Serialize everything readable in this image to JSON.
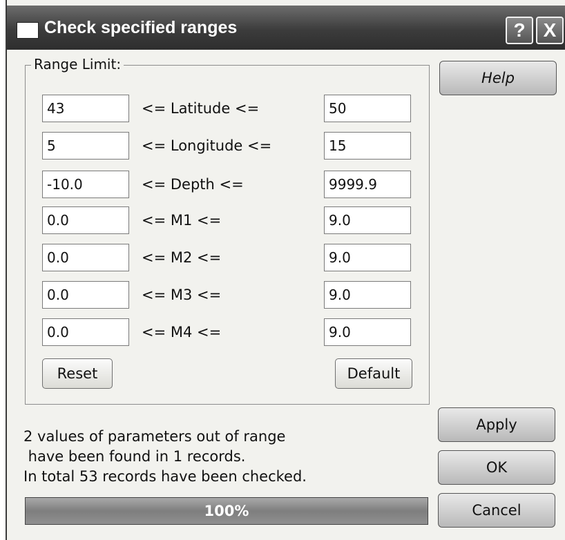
{
  "window": {
    "title": "Check specified ranges",
    "help_glyph": "?",
    "close_glyph": "X"
  },
  "range_group": {
    "label": "Range Limit:",
    "rows": [
      {
        "min": "43",
        "condition": "<= Latitude <=",
        "max": "50"
      },
      {
        "min": "5",
        "condition": "<= Longitude <=",
        "max": "15"
      },
      {
        "min": "-10.0",
        "condition": "<= Depth <=",
        "max": "9999.9"
      },
      {
        "min": "0.0",
        "condition": "<= M1 <=",
        "max": "9.0"
      },
      {
        "min": "0.0",
        "condition": "<= M2 <=",
        "max": "9.0"
      },
      {
        "min": "0.0",
        "condition": "<= M3 <=",
        "max": "9.0"
      },
      {
        "min": "0.0",
        "condition": "<= M4 <=",
        "max": "9.0"
      }
    ],
    "reset_label": "Reset",
    "default_label": "Default"
  },
  "buttons": {
    "help": "Help",
    "apply": "Apply",
    "ok": "OK",
    "cancel": "Cancel"
  },
  "status": {
    "line1": "2 values of parameters out of range",
    "line2": " have been found in 1 records.",
    "line3": "In total 53 records have been checked."
  },
  "progress": {
    "value_percent": 100,
    "label": "100%"
  },
  "colors": {
    "titlebar": "#3c3c3c",
    "dialog_bg": "#f2f2ee",
    "progress_fill": "#8a8a8a"
  }
}
